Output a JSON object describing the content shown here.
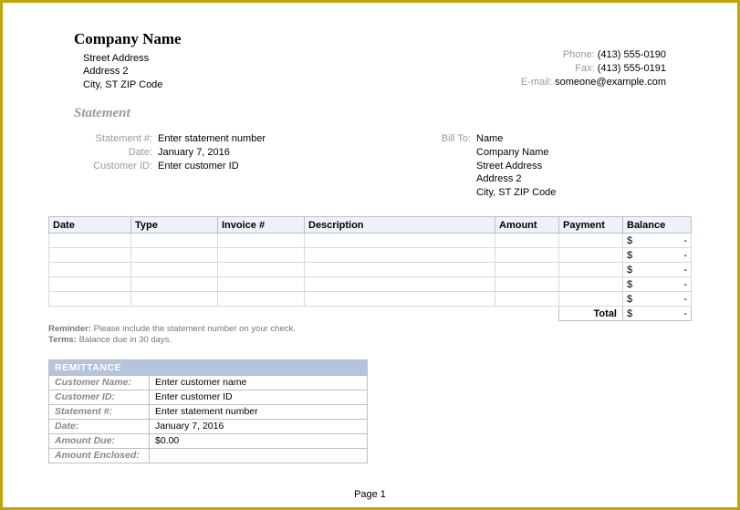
{
  "header": {
    "company_name": "Company Name",
    "address": {
      "street": "Street Address",
      "line2": "Address 2",
      "citystzip": "City, ST  ZIP Code"
    },
    "contact": {
      "phone_label": "Phone:",
      "phone": "(413) 555-0190",
      "fax_label": "Fax:",
      "fax": "(413) 555-0191",
      "email_label": "E-mail:",
      "email": "someone@example.com"
    }
  },
  "statement_heading": "Statement",
  "statement_meta": {
    "statement_num_label": "Statement #:",
    "statement_num": "Enter statement number",
    "date_label": "Date:",
    "date": "January 7, 2016",
    "customer_id_label": "Customer ID:",
    "customer_id": "Enter customer ID"
  },
  "bill_to": {
    "label": "Bill To:",
    "name": "Name",
    "company": "Company Name",
    "street": "Street Address",
    "line2": "Address 2",
    "citystzip": "City, ST  ZIP Code"
  },
  "ledger": {
    "headers": {
      "date": "Date",
      "type": "Type",
      "invoice": "Invoice #",
      "description": "Description",
      "amount": "Amount",
      "payment": "Payment",
      "balance": "Balance"
    },
    "rows": [
      {
        "balance_currency": "$",
        "balance_dash": "-"
      },
      {
        "balance_currency": "$",
        "balance_dash": "-"
      },
      {
        "balance_currency": "$",
        "balance_dash": "-"
      },
      {
        "balance_currency": "$",
        "balance_dash": "-"
      },
      {
        "balance_currency": "$",
        "balance_dash": "-"
      }
    ],
    "total_label": "Total",
    "total_currency": "$",
    "total_dash": "-"
  },
  "notes": {
    "reminder_label": "Reminder:",
    "reminder_text": " Please include the statement number on your check.",
    "terms_label": "Terms:",
    "terms_text": " Balance due in 30 days."
  },
  "remittance": {
    "heading": "REMITTANCE",
    "rows": {
      "customer_name_label": "Customer Name:",
      "customer_name": "Enter customer name",
      "customer_id_label": "Customer ID:",
      "customer_id": "Enter customer ID",
      "statement_num_label": "Statement #:",
      "statement_num": "Enter statement number",
      "date_label": "Date:",
      "date": "January 7, 2016",
      "amount_due_label": "Amount Due:",
      "amount_due": "$0.00",
      "amount_enclosed_label": "Amount Enclosed:",
      "amount_enclosed": ""
    }
  },
  "page_number": "Page 1"
}
